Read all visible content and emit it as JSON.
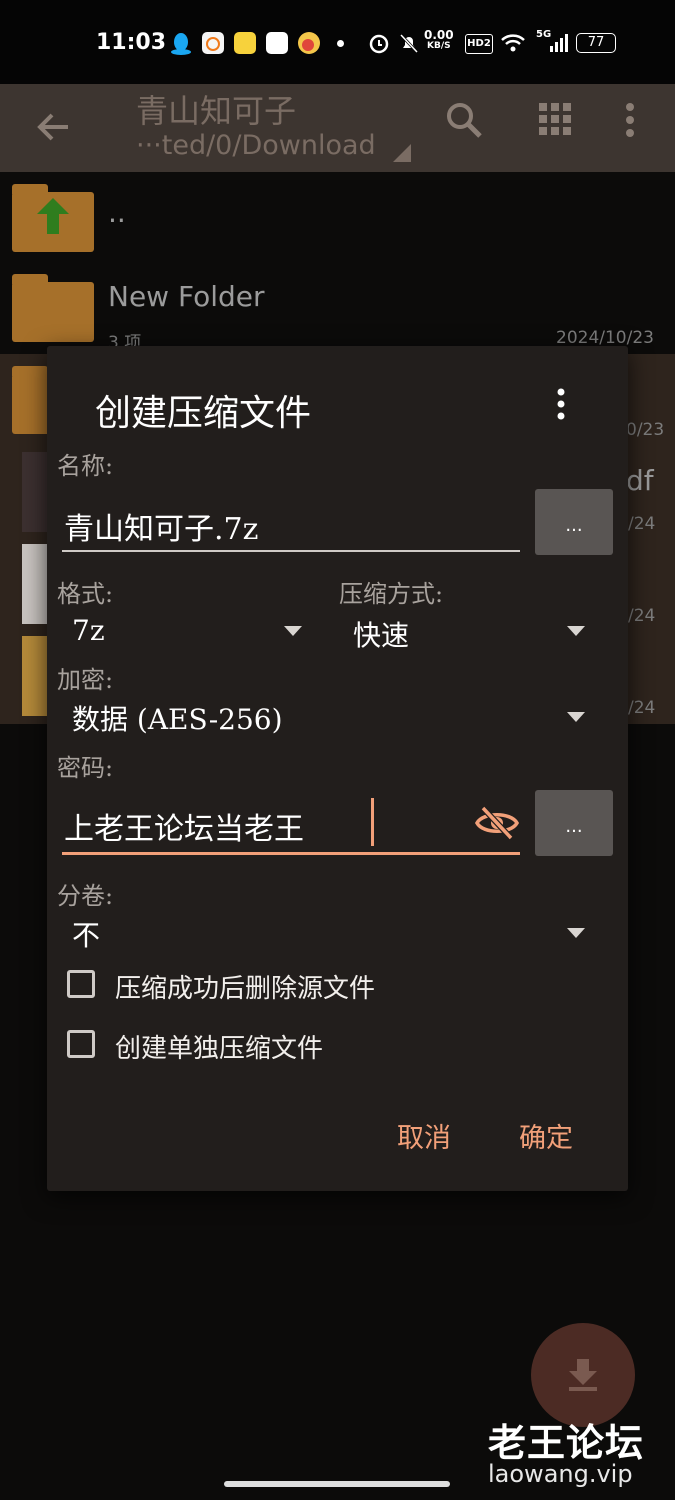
{
  "status_bar": {
    "time": "11:03",
    "net_speed_value": "0.00",
    "net_speed_unit": "KB/S",
    "hd_badge": "HD2",
    "network": "5G",
    "battery": "77"
  },
  "toolbar": {
    "title": "青山知可子",
    "path": "···ted/0/Download",
    "icons": [
      "back-arrow-icon",
      "search-icon",
      "grid-view-icon",
      "more-vert-icon"
    ]
  },
  "file_list": [
    {
      "name": "..",
      "meta": "",
      "date": "",
      "icon": "folder-up-icon"
    },
    {
      "name": "New Folder",
      "meta": "3 项",
      "date": "2024/10/23",
      "icon": "folder-icon"
    },
    {
      "name": "",
      "meta": "",
      "date": "0/23",
      "icon": "folder-icon"
    },
    {
      "name": "df",
      "meta": "",
      "date": "/24",
      "icon": "thumbnail"
    },
    {
      "name": "",
      "meta": "",
      "date": "/24",
      "icon": "thumbnail"
    },
    {
      "name": "",
      "meta": "",
      "date": "/24",
      "icon": "archive-thumbnail"
    }
  ],
  "dialog": {
    "title": "创建压缩文件",
    "name_label": "名称:",
    "name_value": "青山知可子.7z",
    "browse_label": "...",
    "format_label": "格式:",
    "format_value": "7z",
    "method_label": "压缩方式:",
    "method_value": "快速",
    "encryption_label": "加密:",
    "encryption_value": "数据 (AES-256)",
    "password_label": "密码:",
    "password_value": "上老王论坛当老王",
    "split_label": "分卷:",
    "split_value": "不",
    "checkbox_delete": "压缩成功后删除源文件",
    "checkbox_separate": "创建单独压缩文件",
    "cancel": "取消",
    "ok": "确定",
    "accent_color": "#f2a079"
  },
  "watermark": {
    "line1": "老王论坛",
    "line2": "laowang.vip"
  }
}
